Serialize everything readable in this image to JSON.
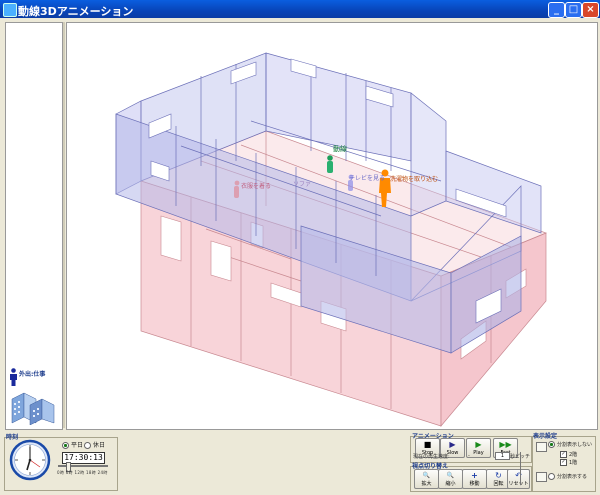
{
  "window": {
    "title": "動線3Dアニメーション",
    "minimize": "_",
    "maximize": "□",
    "close": "×"
  },
  "left_panel": {
    "status_label": "外出:仕事"
  },
  "scene": {
    "labels": [
      {
        "text": "動線",
        "color": "#127d38"
      },
      {
        "text": "テレビを見る",
        "color": "#6c6cc8"
      },
      {
        "text": "衣服を着る",
        "color": "#c06080"
      },
      {
        "text": "ソファ",
        "color": "#9a80c0"
      },
      {
        "text": "洗濯物を取り込む",
        "color": "#c05010"
      }
    ]
  },
  "clock": {
    "group_title": "時刻",
    "weekday_label": "平日",
    "holiday_label": "休日",
    "time": "17:30:13",
    "ticks": [
      "0時",
      "6時",
      "12時",
      "18時",
      "24時"
    ],
    "progress": 0.2
  },
  "animation": {
    "group_title": "アニメーション",
    "buttons": [
      {
        "glyph": "■",
        "label": "Stop"
      },
      {
        "glyph": "▶",
        "label": "Slow"
      },
      {
        "glyph": "▶",
        "label": "Play"
      },
      {
        "glyph": "▶▶",
        "label": "Fast"
      }
    ],
    "current_speed_label": "現在の再生速度:",
    "speed_value": "-",
    "pitch_value": "1",
    "pitch_unit": "秒ピッチ"
  },
  "viewpoint": {
    "group_title": "視点切り替え",
    "buttons": [
      {
        "glyph": "🔍",
        "label": "拡大"
      },
      {
        "glyph": "🔍",
        "label": "縮小"
      },
      {
        "glyph": "+",
        "label": "移動"
      },
      {
        "glyph": "↻",
        "label": "回転"
      },
      {
        "glyph": "↶",
        "label": "リセット"
      }
    ]
  },
  "display": {
    "group_title": "表示設定",
    "no_split_label": "分割表示しない",
    "split_label": "分割表示する",
    "floor2_label": "2階",
    "floor1_label": "1階",
    "check_mark": "✓"
  },
  "colors": {
    "titlebar": "#0a4fcf",
    "walls_upper": "#9a9ce6",
    "walls_lower": "#f0a8b0",
    "accent_text": "#1c3c8c"
  }
}
